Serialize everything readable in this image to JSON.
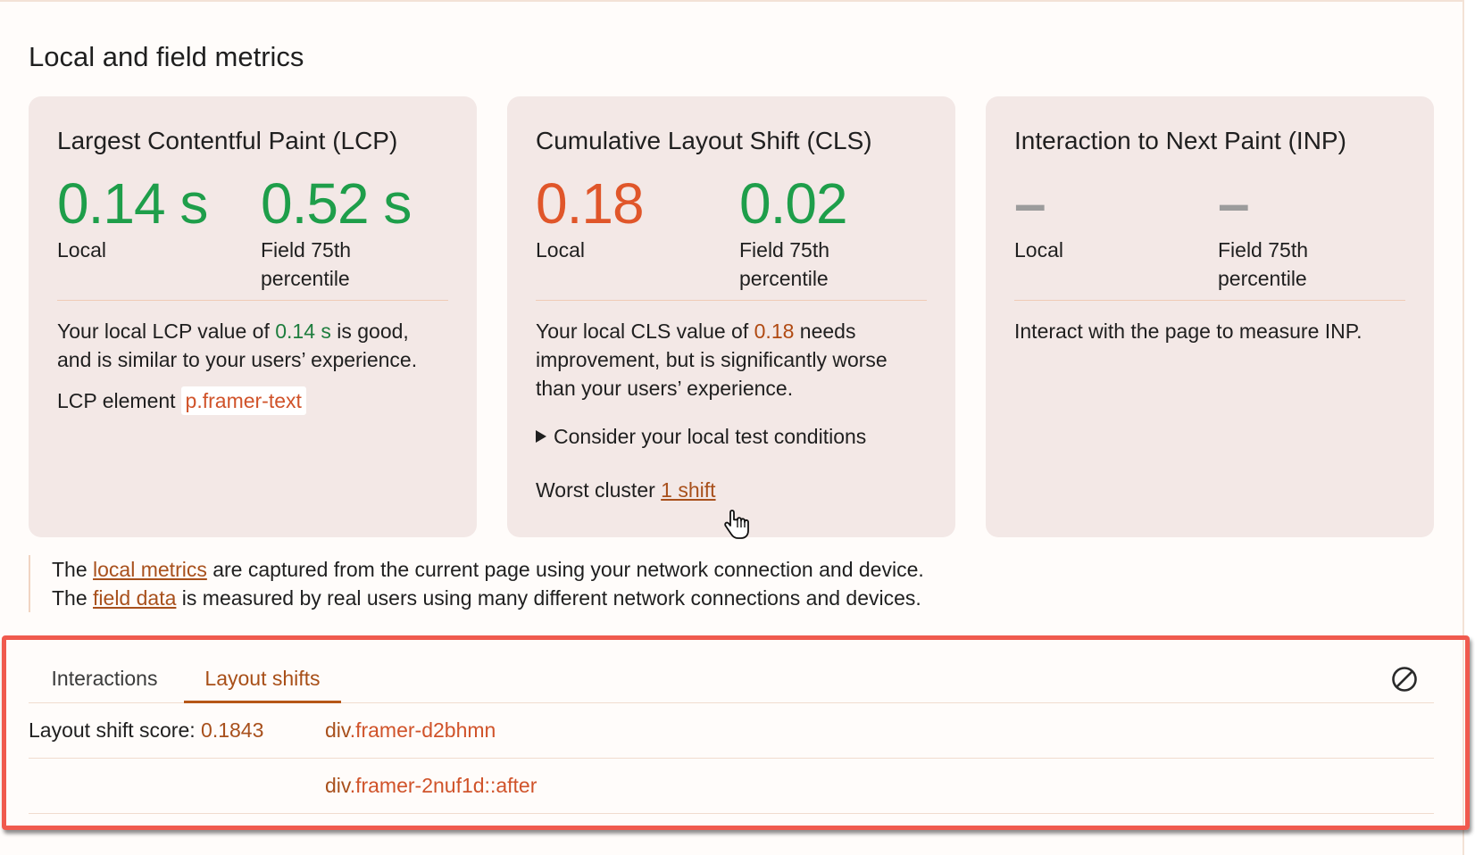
{
  "section_title": "Local and field metrics",
  "cards": {
    "lcp": {
      "title": "Largest Contentful Paint (LCP)",
      "local_value": "0.14 s",
      "local_label": "Local",
      "field_value": "0.52 s",
      "field_label": "Field 75th percentile",
      "desc_prefix": "Your local LCP value of ",
      "desc_value": "0.14 s",
      "desc_suffix": " is good, and is similar to your users’ experience.",
      "element_label": "LCP element",
      "element_value": "p.framer-text"
    },
    "cls": {
      "title": "Cumulative Layout Shift (CLS)",
      "local_value": "0.18",
      "local_label": "Local",
      "field_value": "0.02",
      "field_label": "Field 75th percentile",
      "desc_prefix": "Your local CLS value of ",
      "desc_value": "0.18",
      "desc_suffix": " needs improvement, but is significantly worse than your users’ experience.",
      "consider_label": "Consider your local test conditions",
      "worst_label": "Worst cluster",
      "worst_link": "1 shift"
    },
    "inp": {
      "title": "Interaction to Next Paint (INP)",
      "local_value": "–",
      "local_label": "Local",
      "field_value": "–",
      "field_label": "Field 75th percentile",
      "desc": "Interact with the page to measure INP."
    }
  },
  "notes": {
    "line1_prefix": "The ",
    "line1_link": "local metrics",
    "line1_suffix": " are captured from the current page using your network connection and device.",
    "line2_prefix": "The ",
    "line2_link": "field data",
    "line2_suffix": " is measured by real users using many different network connections and devices."
  },
  "tabs": {
    "interactions": "Interactions",
    "layout_shifts": "Layout shifts"
  },
  "layout_shift": {
    "score_label": "Layout shift score: ",
    "score_value": "0.1843",
    "nodes": [
      {
        "tag": "div",
        "selector": ".framer-d2bhmn"
      },
      {
        "tag": "div",
        "selector": ".framer-2nuf1d::after"
      }
    ]
  },
  "colors": {
    "good": "#1e9e4a",
    "needs_improvement": "#e0562a",
    "link": "#a8501c",
    "highlight_border": "#f05a4e",
    "card_bg": "#f3e8e6"
  },
  "icons": {
    "clear": "clear-icon",
    "cursor": "hand-pointer-cursor-icon",
    "disclosure": "disclosure-triangle-icon"
  }
}
